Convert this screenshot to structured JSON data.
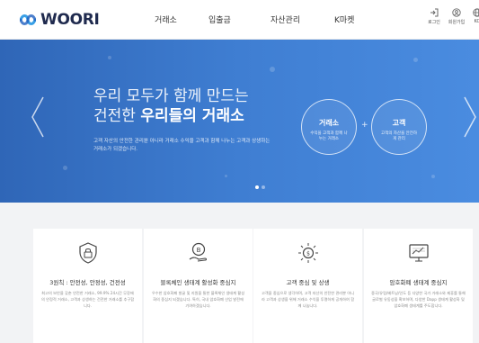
{
  "header": {
    "logo_text": "WOORI",
    "nav": [
      "거래소",
      "입출금",
      "자산관리",
      "K마켓"
    ],
    "utils": [
      {
        "label": "로그인",
        "icon": "login-icon"
      },
      {
        "label": "회원가입",
        "icon": "user-icon"
      },
      {
        "label": "KO",
        "icon": "globe-icon"
      }
    ]
  },
  "hero": {
    "title_line1": "우리 모두가 함께 만드는",
    "title_line2_prefix": "건전한 ",
    "title_line2_bold": "우리들의 거래소",
    "description": "고객 자산의 안전한 관리뿐 아니라 거래소 수익을 고객과 함께 나누는 고객과 상생하는 거래소가 되겠습니다.",
    "circles": [
      {
        "title": "거래소",
        "subtitle": "수익을 고객과 함께 나누는 거래소"
      },
      {
        "title": "고객",
        "subtitle": "고객의 자산을 안전하게 관리"
      }
    ],
    "plus": "+",
    "pager_active": 1,
    "pager_count": 2
  },
  "features": [
    {
      "icon": "shield-lock-icon",
      "title": "3원칙 : 안전성, 안정성, 건전성",
      "description": "최고의 보안을 갖춘 안전한 거래소, 99.9% 24시간 무장애의 안정적 거래소, 고객과 상생하는 건전한 거래소를 추구합니다."
    },
    {
      "icon": "coin-hand-icon",
      "title": "블록체인 생태계 활성화 중심지",
      "description": "우수한 암호화폐 발굴 및 지원을 통한 블록체인 생태계 활성화의 중심지 되겠습니다. 특히, 국내 암호화폐 산업 발전에 기여하겠습니다."
    },
    {
      "icon": "customer-center-icon",
      "title": "고객 중심 및 상생",
      "description": "고객을 중심으로 생각하며, 고객 자산의 안전한 관리뿐 아니라 고객과 상생을 위해 거래소 수익을 투명하게 공개하여 함께 나눕니다."
    },
    {
      "icon": "monitor-chart-icon",
      "title": "암호화폐 생태계 중심지",
      "description": "중국/유럽/베트남/인도 등 다양한 국가 거래소와 제휴를 통해 글로벌 유동성을 확보하며, 다양한 Dapp 생태계 활성화 및 암호화폐 생태계를 주도합니다."
    }
  ],
  "colors": {
    "hero_start": "#2f66b7",
    "hero_end": "#4a8ce0",
    "logo_blue": "#3aa0e6",
    "features_bg": "#f2f3f5"
  }
}
